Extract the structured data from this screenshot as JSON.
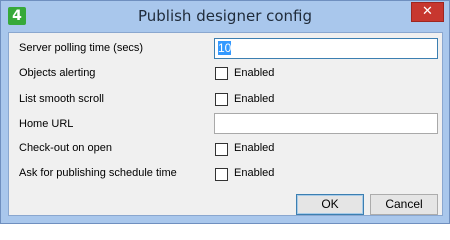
{
  "window": {
    "title": "Publish designer config",
    "app_icon_glyph": "4",
    "close_glyph": "✕"
  },
  "form": {
    "rows": [
      {
        "label": "Server polling time (secs)",
        "control": "text",
        "value": "10"
      },
      {
        "label": "Objects alerting",
        "control": "checkbox",
        "checked": false,
        "checkbox_label": "Enabled"
      },
      {
        "label": "List smooth scroll",
        "control": "checkbox",
        "checked": false,
        "checkbox_label": "Enabled"
      },
      {
        "label": "Home URL",
        "control": "text",
        "value": ""
      },
      {
        "label": "Check-out on open",
        "control": "checkbox",
        "checked": false,
        "checkbox_label": "Enabled"
      },
      {
        "label": "Ask for publishing schedule time",
        "control": "checkbox",
        "checked": false,
        "checkbox_label": "Enabled"
      }
    ]
  },
  "buttons": {
    "ok": "OK",
    "cancel": "Cancel"
  },
  "colors": {
    "frame": "#a9c7ec",
    "client_bg": "#f0f0f0",
    "close_button": "#c7372f",
    "selection": "#3399ff",
    "app_icon": "#37a93a"
  }
}
